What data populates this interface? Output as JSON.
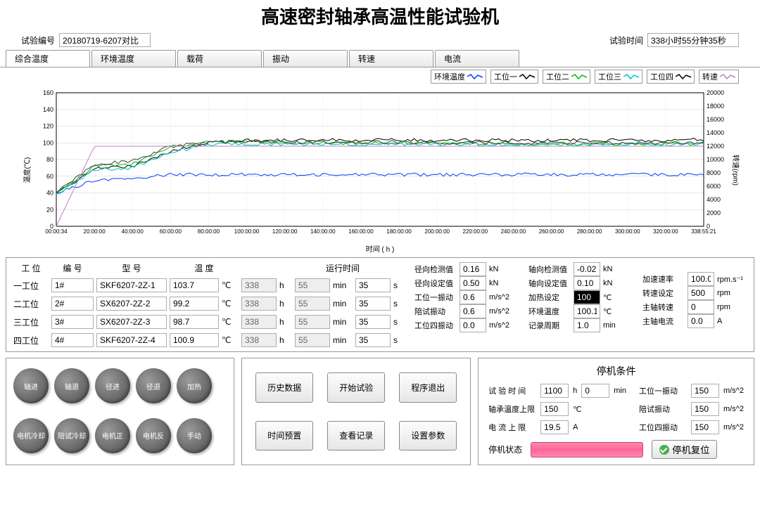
{
  "title": "高速密封轴承高温性能试验机",
  "header": {
    "test_no_label": "试验编号",
    "test_no": "20180719-6207对比",
    "test_time_label": "试验时间",
    "test_time": "338小时55分钟35秒"
  },
  "tabs": [
    "综合温度",
    "环境温度",
    "载荷",
    "振动",
    "转速",
    "电流"
  ],
  "legend": [
    {
      "name": "环境温度",
      "color": "#0040ff"
    },
    {
      "name": "工位一",
      "color": "#000000"
    },
    {
      "name": "工位二",
      "color": "#00c000"
    },
    {
      "name": "工位三",
      "color": "#00c0c0"
    },
    {
      "name": "工位四",
      "color": "#000000"
    },
    {
      "name": "转速",
      "color": "#c080c0"
    }
  ],
  "chart_data": {
    "type": "line",
    "xlabel": "时间 ( h )",
    "ylabel_left": "温度(℃)",
    "ylabel_right": "转速(rpm)",
    "ylim_left": [
      0,
      160
    ],
    "ylim_right": [
      0,
      20000
    ],
    "x_ticks": [
      "00:00:34",
      "20:00:00",
      "40:00:00",
      "60:00:00",
      "80:00:00",
      "100:00:00",
      "120:00:00",
      "140:00:00",
      "160:00:00",
      "180:00:00",
      "200:00:00",
      "220:00:00",
      "240:00:00",
      "260:00:00",
      "280:00:00",
      "300:00:00",
      "320:00:00",
      "338:55:21"
    ],
    "y_ticks_left": [
      0,
      20,
      40,
      60,
      80,
      100,
      120,
      140,
      160
    ],
    "y_ticks_right": [
      0,
      2000,
      4000,
      6000,
      8000,
      10000,
      12000,
      14000,
      16000,
      18000,
      20000
    ],
    "series": [
      {
        "name": "环境温度",
        "color": "#0040ff",
        "axis": "left",
        "values": [
          40,
          55,
          58,
          62,
          62,
          62,
          62,
          62,
          62,
          62,
          62,
          62,
          62,
          62,
          62,
          62,
          62,
          62
        ]
      },
      {
        "name": "工位一",
        "color": "#000000",
        "axis": "left",
        "values": [
          38,
          70,
          72,
          90,
          100,
          103,
          103,
          104,
          103,
          104,
          103,
          103,
          103,
          103,
          103,
          103,
          103,
          104
        ]
      },
      {
        "name": "工位二",
        "color": "#00c000",
        "axis": "left",
        "values": [
          40,
          72,
          75,
          95,
          102,
          101,
          100,
          100,
          99,
          100,
          99,
          99,
          99,
          99,
          99,
          99,
          99,
          99
        ]
      },
      {
        "name": "工位三",
        "color": "#00c0c0",
        "axis": "left",
        "values": [
          38,
          68,
          70,
          88,
          98,
          99,
          98,
          99,
          98,
          99,
          98,
          98,
          98,
          98,
          98,
          98,
          98,
          99
        ]
      },
      {
        "name": "工位四",
        "color": "#404040",
        "axis": "left",
        "values": [
          42,
          74,
          78,
          96,
          101,
          101,
          101,
          101,
          100,
          101,
          100,
          100,
          100,
          100,
          100,
          100,
          100,
          101
        ]
      },
      {
        "name": "转速",
        "color": "#c080c0",
        "axis": "right",
        "values": [
          0,
          12000,
          12000,
          12000,
          12000,
          12000,
          12000,
          12000,
          12000,
          12000,
          12000,
          12000,
          12000,
          12000,
          12000,
          12000,
          12000,
          12000
        ]
      }
    ]
  },
  "ws_headers": {
    "pos": "工 位",
    "id": "编 号",
    "model": "型 号",
    "temp": "温 度",
    "runtime": "运行时间"
  },
  "workstations": [
    {
      "pos": "一工位",
      "id": "1#",
      "model": "SKF6207-2Z-1",
      "temp": "103.7",
      "h": "338",
      "min": "55",
      "s": "35"
    },
    {
      "pos": "二工位",
      "id": "2#",
      "model": "SX6207-2Z-2",
      "temp": "99.2",
      "h": "338",
      "min": "55",
      "s": "35"
    },
    {
      "pos": "三工位",
      "id": "3#",
      "model": "SX6207-2Z-3",
      "temp": "98.7",
      "h": "338",
      "min": "55",
      "s": "35"
    },
    {
      "pos": "四工位",
      "id": "4#",
      "model": "SKF6207-2Z-4",
      "temp": "100.9",
      "h": "338",
      "min": "55",
      "s": "35"
    }
  ],
  "units": {
    "h": "h",
    "min": "min",
    "s": "s",
    "c": "℃"
  },
  "measurements": {
    "col1": [
      {
        "lbl": "径向检测值",
        "val": "0.16",
        "unit": "kN"
      },
      {
        "lbl": "径向设定值",
        "val": "0.50",
        "unit": "kN"
      },
      {
        "lbl": "工位一振动",
        "val": "0.6",
        "unit": "m/s^2"
      },
      {
        "lbl": "陪试振动",
        "val": "0.6",
        "unit": "m/s^2"
      },
      {
        "lbl": "工位四振动",
        "val": "0.0",
        "unit": "m/s^2"
      }
    ],
    "col2": [
      {
        "lbl": "轴向检测值",
        "val": "-0.02",
        "unit": "kN"
      },
      {
        "lbl": "轴向设定值",
        "val": "0.10",
        "unit": "kN"
      },
      {
        "lbl": "加热设定",
        "val": "100",
        "unit": "℃",
        "hl": true
      },
      {
        "lbl": "环境温度",
        "val": "100.1",
        "unit": "℃"
      },
      {
        "lbl": "记录周期",
        "val": "1.0",
        "unit": "min"
      }
    ],
    "col3": [
      {
        "lbl": "",
        "val": "",
        "unit": ""
      },
      {
        "lbl": "加速速率",
        "val": "100.0",
        "unit": "rpm.s⁻¹"
      },
      {
        "lbl": "转速设定",
        "val": "500",
        "unit": "rpm"
      },
      {
        "lbl": "主轴转速",
        "val": "0",
        "unit": "rpm"
      },
      {
        "lbl": "主轴电流",
        "val": "0.0",
        "unit": "A"
      }
    ]
  },
  "circle_buttons": {
    "row1": [
      "轴进",
      "轴退",
      "径进",
      "径退",
      "加热"
    ],
    "row2": [
      "电机冷却",
      "陪试冷却",
      "电机正",
      "电机反",
      "手动"
    ]
  },
  "rect_buttons": {
    "row1": [
      "历史数据",
      "开始试验",
      "程序退出"
    ],
    "row2": [
      "时间预置",
      "查看记录",
      "设置参数"
    ]
  },
  "stop": {
    "title": "停机条件",
    "rows": [
      {
        "lbl": "试 验 时 间",
        "v1": "1100",
        "u1": "h",
        "v2": "0",
        "u2": "min"
      },
      {
        "lbl": "工位一振动",
        "v1": "150",
        "u1": "m/s^2"
      },
      {
        "lbl": "轴承温度上限",
        "v1": "150",
        "u1": "℃"
      },
      {
        "lbl": "陪试振动",
        "v1": "150",
        "u1": "m/s^2"
      },
      {
        "lbl": "电 流 上 限",
        "v1": "19.5",
        "u1": "A"
      },
      {
        "lbl": "工位四振动",
        "v1": "150",
        "u1": "m/s^2"
      }
    ],
    "status_label": "停机状态",
    "reset": "停机复位"
  }
}
